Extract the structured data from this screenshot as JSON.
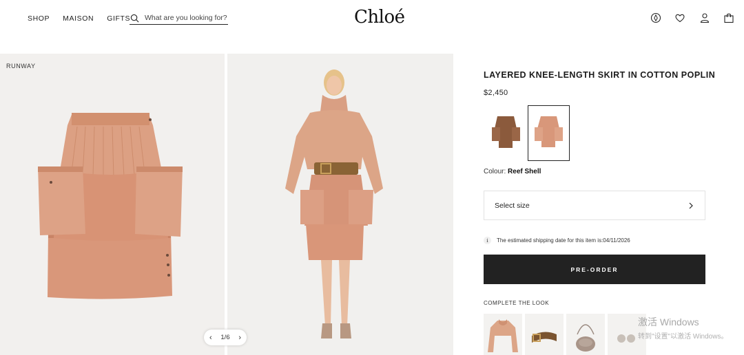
{
  "header": {
    "nav": [
      "SHOP",
      "MAISON",
      "GIFTS"
    ],
    "search_placeholder": "What are you looking for?",
    "logo": "Chloé",
    "icons": [
      "store-locator-icon",
      "wishlist-heart-icon",
      "account-icon",
      "shopping-bag-icon"
    ]
  },
  "gallery": {
    "label": "RUNWAY",
    "pager": {
      "text": "1/6",
      "prev": "‹",
      "next": "›"
    }
  },
  "product": {
    "title": "LAYERED KNEE-LENGTH SKIRT IN COTTON POPLIN",
    "price": "$2,450",
    "swatches": [
      {
        "name": "brown-skirt",
        "color": "#8b5a3c",
        "selected": false
      },
      {
        "name": "reef-shell-skirt",
        "color": "#d8977a",
        "selected": true
      }
    ],
    "colour_label": "Colour:",
    "colour_value": "Reef Shell",
    "size_placeholder": "Select size",
    "shipping_note": "The estimated shipping date for this item is:04/11/2026",
    "cta": "PRE-ORDER",
    "complete_the_look": "COMPLETE THE LOOK"
  },
  "watermark": {
    "title": "激活 Windows",
    "subtitle": "转到\"设置\"以激活 Windows。"
  },
  "colors": {
    "product": "#d9977a",
    "product_shade": "#c98466",
    "cta_bg": "#222222",
    "swatch_brown": "#8b5a3c"
  }
}
